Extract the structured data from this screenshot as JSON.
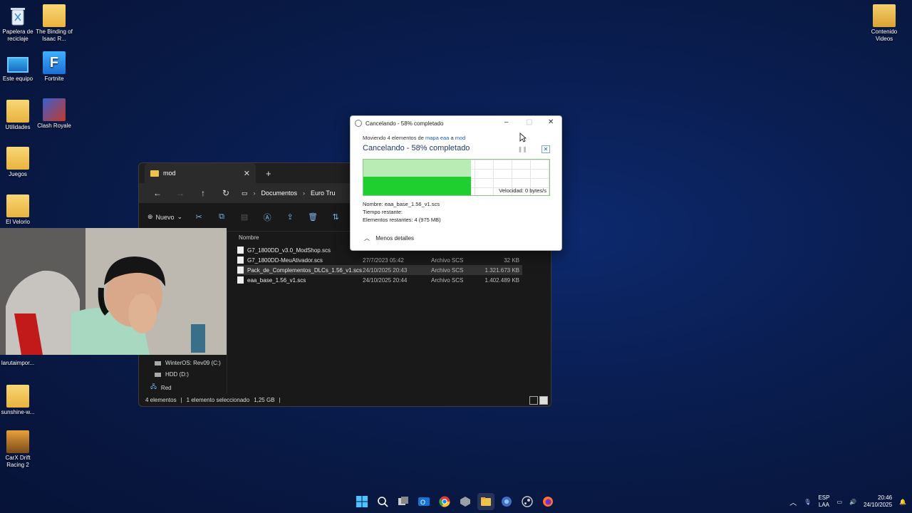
{
  "desktop": {
    "icons": [
      {
        "label": "Papelera de reciclaje",
        "icon": "recycle-bin-icon"
      },
      {
        "label": "The Binding of Isaac R...",
        "icon": "folder-icon"
      },
      {
        "label": "Este equipo",
        "icon": "monitor-icon"
      },
      {
        "label": "Fortnite",
        "icon": "fortnite-icon"
      },
      {
        "label": "Utilidades",
        "icon": "folder-icon"
      },
      {
        "label": "Clash Royale",
        "icon": "clash-royale-icon"
      },
      {
        "label": "Juegos",
        "icon": "folder-icon"
      },
      {
        "label": "El Velorio",
        "icon": "folder-icon"
      },
      {
        "label": "larutaimpor...",
        "icon": "file-icon"
      },
      {
        "label": "sunshine-w...",
        "icon": "folder-icon"
      },
      {
        "label": "CarX Drift Racing 2",
        "icon": "carx-icon"
      },
      {
        "label": "Contenido Videos",
        "icon": "folder-icon"
      }
    ]
  },
  "explorer": {
    "tab_title": "mod",
    "crumbs": [
      "Documentos",
      "Euro Tru"
    ],
    "toolbar": {
      "new_label": "Nuevo"
    },
    "column_name": "Nombre",
    "sidebar": [
      {
        "label": "WinterOS: Rev09  (C:)"
      },
      {
        "label": "HDD (D:)"
      },
      {
        "label": "Red"
      }
    ],
    "files": [
      {
        "name": "G7_1800DD_v3.0_ModShop.scs",
        "date": "",
        "type": "",
        "size": ""
      },
      {
        "name": "G7_1800DD-MeuAtivador.scs",
        "date": "27/7/2023 05:42",
        "type": "Archivo SCS",
        "size": "32 KB"
      },
      {
        "name": "Pack_de_Complementos_DLCs_1.56_v1.scs",
        "date": "24/10/2025 20:43",
        "type": "Archivo SCS",
        "size": "1.321.673 KB"
      },
      {
        "name": "eaa_base_1.56_v1.scs",
        "date": "24/10/2025 20:44",
        "type": "Archivo SCS",
        "size": "1.402.489 KB"
      }
    ],
    "status": {
      "count": "4 elementos",
      "selection": "1 elemento seleccionado",
      "size": "1,25 GB"
    }
  },
  "dialog": {
    "title": "Cancelando - 58% completado",
    "moving_prefix": "Moviendo 4 elementos de",
    "source": "mapa eaa",
    "moving_mid": "a",
    "destination": "mod",
    "headline": "Cancelando - 58% completado",
    "progress_fraction": 0.58,
    "speed": "Velocidad: 0 bytes/s",
    "name_label": "Nombre:",
    "name_value": "eaa_base_1.56_v1.scs",
    "time_label": "Tiempo restante:",
    "remaining_label": "Elementos restantes:",
    "remaining_value": "4 (975 MB)",
    "less_details": "Menos detalles"
  },
  "taskbar": {
    "apps": [
      "windows-start-icon",
      "search-icon",
      "task-view-icon",
      "outlook-icon",
      "chrome-icon",
      "app-icon",
      "file-explorer-icon",
      "app-circle-icon",
      "steam-icon",
      "firefox-icon"
    ],
    "lang_top": "ESP",
    "lang_bottom": "LAA",
    "time": "20:46",
    "date": "24/10/2025"
  },
  "colors": {
    "desktop_bg": "#0a1f55",
    "progress_green": "#1fcf30",
    "link_blue": "#1a5fb4"
  }
}
